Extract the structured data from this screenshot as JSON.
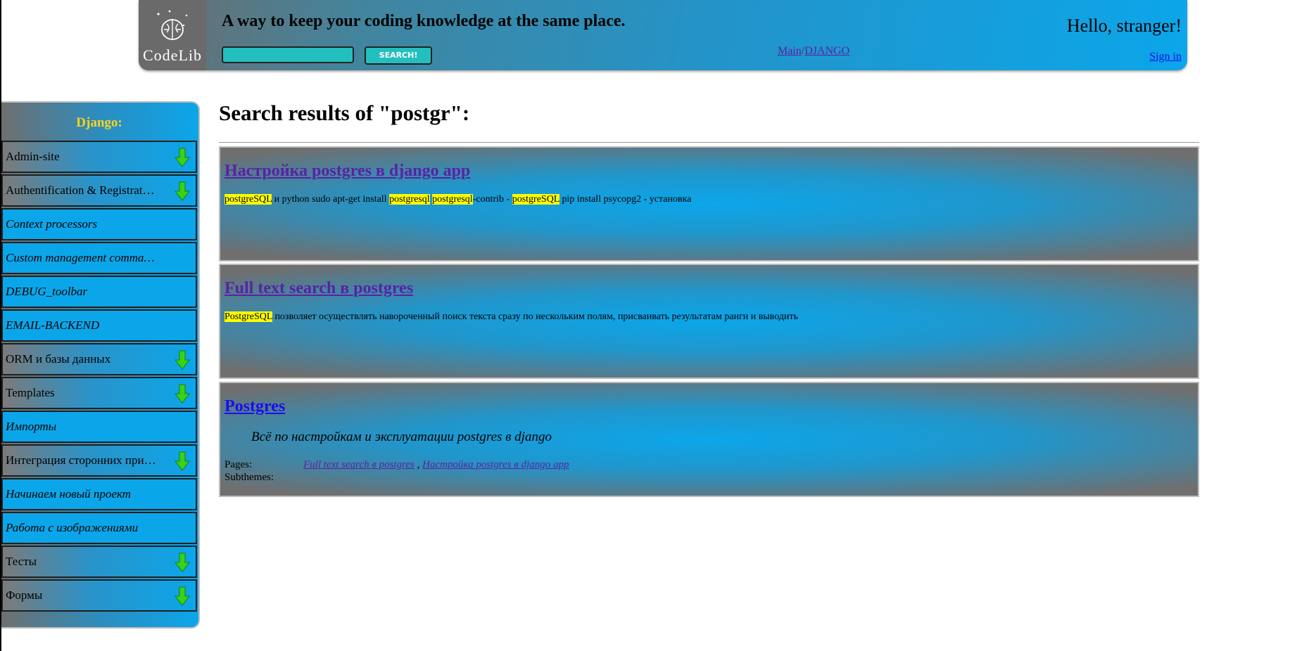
{
  "header": {
    "logo_text": "CodeLib",
    "tagline": "A way to keep your coding knowledge at the same place.",
    "search": {
      "value": "",
      "placeholder": "",
      "button_label": "SEARCH!"
    },
    "breadcrumb": [
      "Main",
      "DJANGO"
    ],
    "breadcrumb_sep": "/",
    "greeting": "Hello, stranger!",
    "signin_label": "Sign in"
  },
  "sidebar": {
    "title": "Django:",
    "items": [
      {
        "label": "Admin-site",
        "type": "folder"
      },
      {
        "label": "Authentification & Registration",
        "type": "folder"
      },
      {
        "label": "Context processors",
        "type": "page"
      },
      {
        "label": "Custom management commands",
        "type": "page"
      },
      {
        "label": "DEBUG_toolbar",
        "type": "page"
      },
      {
        "label": "EMAIL-BACKEND",
        "type": "page"
      },
      {
        "label": "ORM и базы данных",
        "type": "folder"
      },
      {
        "label": "Templates",
        "type": "folder"
      },
      {
        "label": "Импорты",
        "type": "page"
      },
      {
        "label": "Интеграция сторонних приложений",
        "type": "folder"
      },
      {
        "label": "Начинаем новый проект",
        "type": "page"
      },
      {
        "label": "Работа с изображениями",
        "type": "page"
      },
      {
        "label": "Тесты",
        "type": "folder"
      },
      {
        "label": "Формы",
        "type": "folder"
      }
    ]
  },
  "main": {
    "heading": "Search results of \"postgr\":",
    "results": [
      {
        "title": "Настройка postgres в django app",
        "snippet": [
          {
            "t": "postgreSQL",
            "hl": true
          },
          {
            "t": " и python sudo apt-get install ",
            "hl": false
          },
          {
            "t": "postgresql",
            "hl": true
          },
          {
            "t": " ",
            "hl": false
          },
          {
            "t": "postgresql",
            "hl": true
          },
          {
            "t": "-contrib - ",
            "hl": false
          },
          {
            "t": "postgreSQL",
            "hl": true
          },
          {
            "t": " pip install psycopg2 - установка",
            "hl": false
          }
        ]
      },
      {
        "title": "Full text search в postgres",
        "snippet": [
          {
            "t": "PostgreSQL",
            "hl": true
          },
          {
            "t": " позволяет осуществлять навороченный поиск текста сразу по нескольким полям, присваивать результатам ранги и выводить",
            "hl": false
          }
        ]
      }
    ],
    "theme": {
      "title": "Postgres",
      "description": "Всё по настройкам и эксплуатации postgres в django",
      "pages_label": "Pages:",
      "pages": [
        "Full text search в postgres",
        "Настройка postgres в django app"
      ],
      "pages_sep": " , ",
      "subthemes_label": "Subthemes:"
    }
  },
  "colors": {
    "accent": "#0ba6ea",
    "highlight": "#ffff00",
    "sidebar_title": "#ffd21d",
    "search_field": "#23bfbf",
    "visited_link": "#5a21a5",
    "link": "#1a0dee",
    "arrow": "#35d416"
  }
}
